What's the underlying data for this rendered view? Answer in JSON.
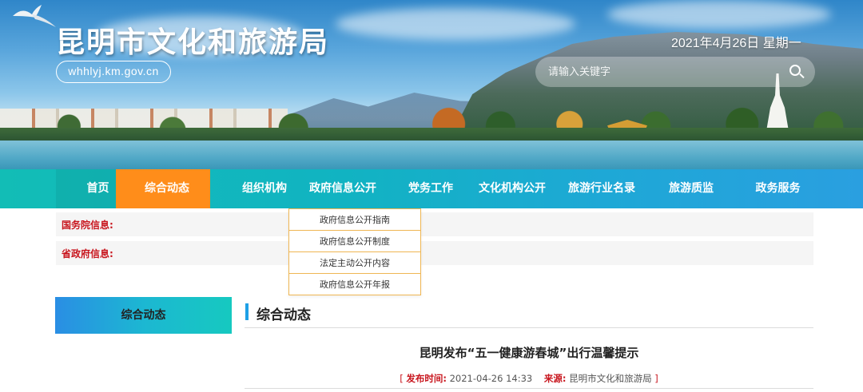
{
  "header": {
    "site_title": "昆明市文化和旅游局",
    "domain": "whhlyj.km.gov.cn",
    "date": "2021年4月26日 星期一",
    "search_placeholder": "请输入关键字"
  },
  "nav": {
    "items": [
      {
        "label": "首页"
      },
      {
        "label": "综合动态"
      },
      {
        "label": "组织机构"
      },
      {
        "label": "政府信息公开"
      },
      {
        "label": "党务工作"
      },
      {
        "label": "文化机构公开"
      },
      {
        "label": "旅游行业名录"
      },
      {
        "label": "旅游质监"
      },
      {
        "label": "政务服务"
      }
    ],
    "active_index": 1
  },
  "dropdown": {
    "items": [
      {
        "label": "政府信息公开指南"
      },
      {
        "label": "政府信息公开制度"
      },
      {
        "label": "法定主动公开内容"
      },
      {
        "label": "政府信息公开年报"
      }
    ]
  },
  "info": {
    "state_council_label": "国务院信息:",
    "province_label": "省政府信息:"
  },
  "sidebar": {
    "title": "综合动态"
  },
  "section": {
    "title": "综合动态"
  },
  "article": {
    "title": "昆明发布“五一健康游春城”出行温馨提示",
    "meta_open": "[",
    "publish_label": "发布时间:",
    "publish_time": "2021-04-26 14:33",
    "source_label": "来源:",
    "source": "昆明市文化和旅游局",
    "meta_close": "]"
  },
  "colors": {
    "nav_start": "#12bdb6",
    "nav_end": "#2a9fe0",
    "nav_active": "#ff8d1a",
    "label_red": "#c8161e",
    "dropdown_border": "#efb653",
    "section_bar": "#1ea0e6"
  }
}
